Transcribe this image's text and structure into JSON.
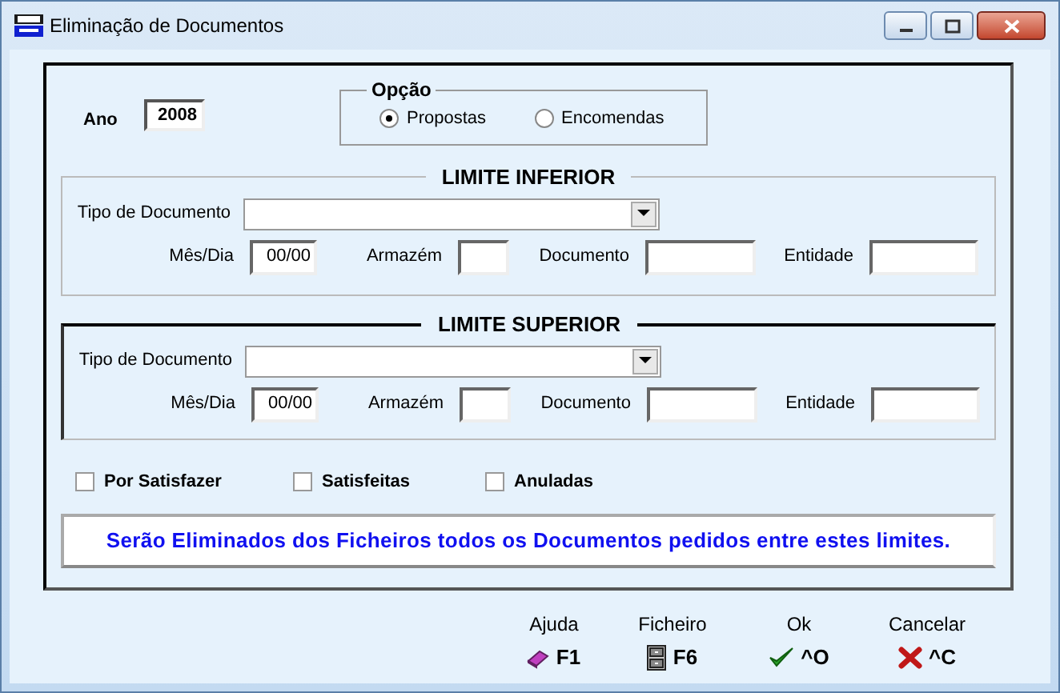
{
  "window": {
    "title": "Eliminação de Documentos"
  },
  "ano": {
    "label": "Ano",
    "value": "2008"
  },
  "opcao": {
    "title": "Opção",
    "options": [
      {
        "label": "Propostas",
        "selected": true
      },
      {
        "label": "Encomendas",
        "selected": false
      }
    ]
  },
  "limits": [
    {
      "title": "LIMITE INFERIOR",
      "tipo_label": "Tipo de Documento",
      "fields": [
        {
          "label": "Mês/Dia",
          "value": "00/00"
        },
        {
          "label": "Armazém"
        },
        {
          "label": "Documento"
        },
        {
          "label": "Entidade"
        }
      ]
    },
    {
      "title": "LIMITE SUPERIOR",
      "tipo_label": "Tipo de Documento",
      "fields": [
        {
          "label": "Mês/Dia",
          "value": "00/00"
        },
        {
          "label": "Armazém"
        },
        {
          "label": "Documento"
        },
        {
          "label": "Entidade"
        }
      ]
    }
  ],
  "filters": [
    {
      "label": "Por Satisfazer",
      "checked": false
    },
    {
      "label": "Satisfeitas",
      "checked": false
    },
    {
      "label": "Anuladas",
      "checked": false
    }
  ],
  "message": "Serão Eliminados dos Ficheiros todos os Documentos pedidos entre estes limites.",
  "buttons": [
    {
      "kind": "help",
      "label": "Ajuda",
      "shortcut": "F1"
    },
    {
      "kind": "file",
      "label": "Ficheiro",
      "shortcut": "F6"
    },
    {
      "kind": "ok",
      "label": "Ok",
      "shortcut": "^O"
    },
    {
      "kind": "cancel",
      "label": "Cancelar",
      "shortcut": "^C"
    }
  ]
}
